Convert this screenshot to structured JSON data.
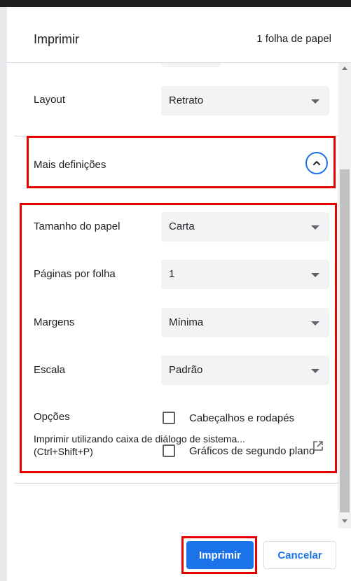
{
  "header": {
    "title": "Imprimir",
    "sheet_count": "1 folha de papel"
  },
  "settings": {
    "layout": {
      "label": "Layout",
      "value": "Retrato"
    },
    "more_settings": {
      "label": "Mais definições",
      "icon": "chevron-up-icon"
    },
    "paper_size": {
      "label": "Tamanho do papel",
      "value": "Carta"
    },
    "pages_per_sheet": {
      "label": "Páginas por folha",
      "value": "1"
    },
    "margins": {
      "label": "Margens",
      "value": "Mínima"
    },
    "scale": {
      "label": "Escala",
      "value": "Padrão"
    },
    "options": {
      "label": "Opções",
      "items": [
        {
          "label": "Cabeçalhos e rodapés",
          "checked": false
        },
        {
          "label": "Gráficos de segundo plano",
          "checked": false
        }
      ]
    },
    "system_dialog": {
      "line1": "Imprimir utilizando caixa de diálogo de sistema...",
      "line2": "(Ctrl+Shift+P)"
    }
  },
  "footer": {
    "print_label": "Imprimir",
    "cancel_label": "Cancelar"
  },
  "colors": {
    "accent": "#1a73e8",
    "highlight_box": "#e60000"
  }
}
